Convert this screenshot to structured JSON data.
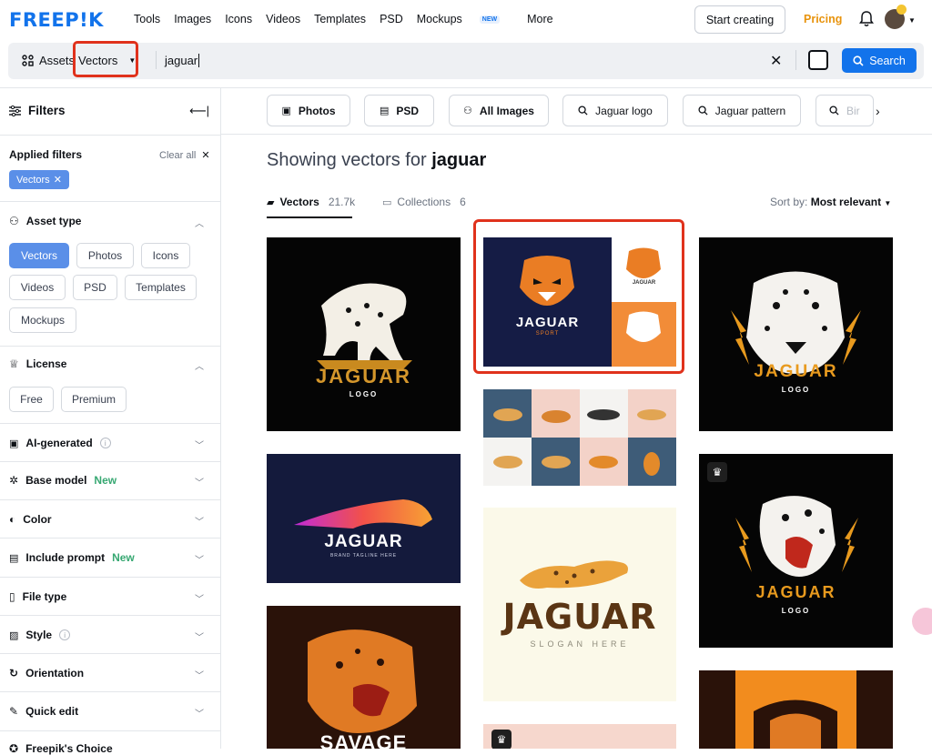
{
  "header": {
    "logo": "FREEP!K",
    "nav": [
      "Tools",
      "Images",
      "Icons",
      "Videos",
      "Templates",
      "PSD",
      "Mockups",
      "More"
    ],
    "new_badge": "NEW",
    "start_creating": "Start creating",
    "pricing": "Pricing"
  },
  "search": {
    "asset_label": "Assets",
    "asset_value": "Vectors",
    "query": "jaguar",
    "button": "Search"
  },
  "sidebar": {
    "title": "Filters",
    "applied_title": "Applied filters",
    "clear_all": "Clear all",
    "applied_chip": "Vectors",
    "asset_type": {
      "title": "Asset type",
      "options": [
        "Vectors",
        "Photos",
        "Icons",
        "Videos",
        "PSD",
        "Templates",
        "Mockups"
      ]
    },
    "license": {
      "title": "License",
      "options": [
        "Free",
        "Premium"
      ]
    },
    "sections": {
      "ai_generated": "AI-generated",
      "base_model": "Base model",
      "color": "Color",
      "include_prompt": "Include prompt",
      "file_type": "File type",
      "style": "Style",
      "orientation": "Orientation",
      "quick_edit": "Quick edit",
      "freepik_choice": "Freepik's Choice"
    },
    "new_label": "New"
  },
  "chips": [
    "Photos",
    "PSD",
    "All Images",
    "Jaguar logo",
    "Jaguar pattern",
    "Bir"
  ],
  "results": {
    "showing_prefix": "Showing vectors for",
    "query": "jaguar",
    "tab_vectors": "Vectors",
    "tab_vectors_count": "21.7k",
    "tab_collections": "Collections",
    "tab_collections_count": "6",
    "sort_label": "Sort by:",
    "sort_value": "Most relevant"
  },
  "tiles": {
    "t1_title": "JAGUAR",
    "t1_sub": "LOGO",
    "t2_title": "JAGUAR",
    "t2_sub": "SPORT",
    "t2_small": "JAGUAR",
    "t3_title": "JAGUAR",
    "t3_sub": "LOGO",
    "t4_title": "JAGUAR",
    "t4_sub": "BRAND TAGLINE HERE",
    "t6_title": "JAGUAR",
    "t6_sub": "SLOGAN HERE",
    "t7_title": "JAGUAR",
    "t7_sub": "LOGO",
    "t8_title": "SAVAGE"
  }
}
